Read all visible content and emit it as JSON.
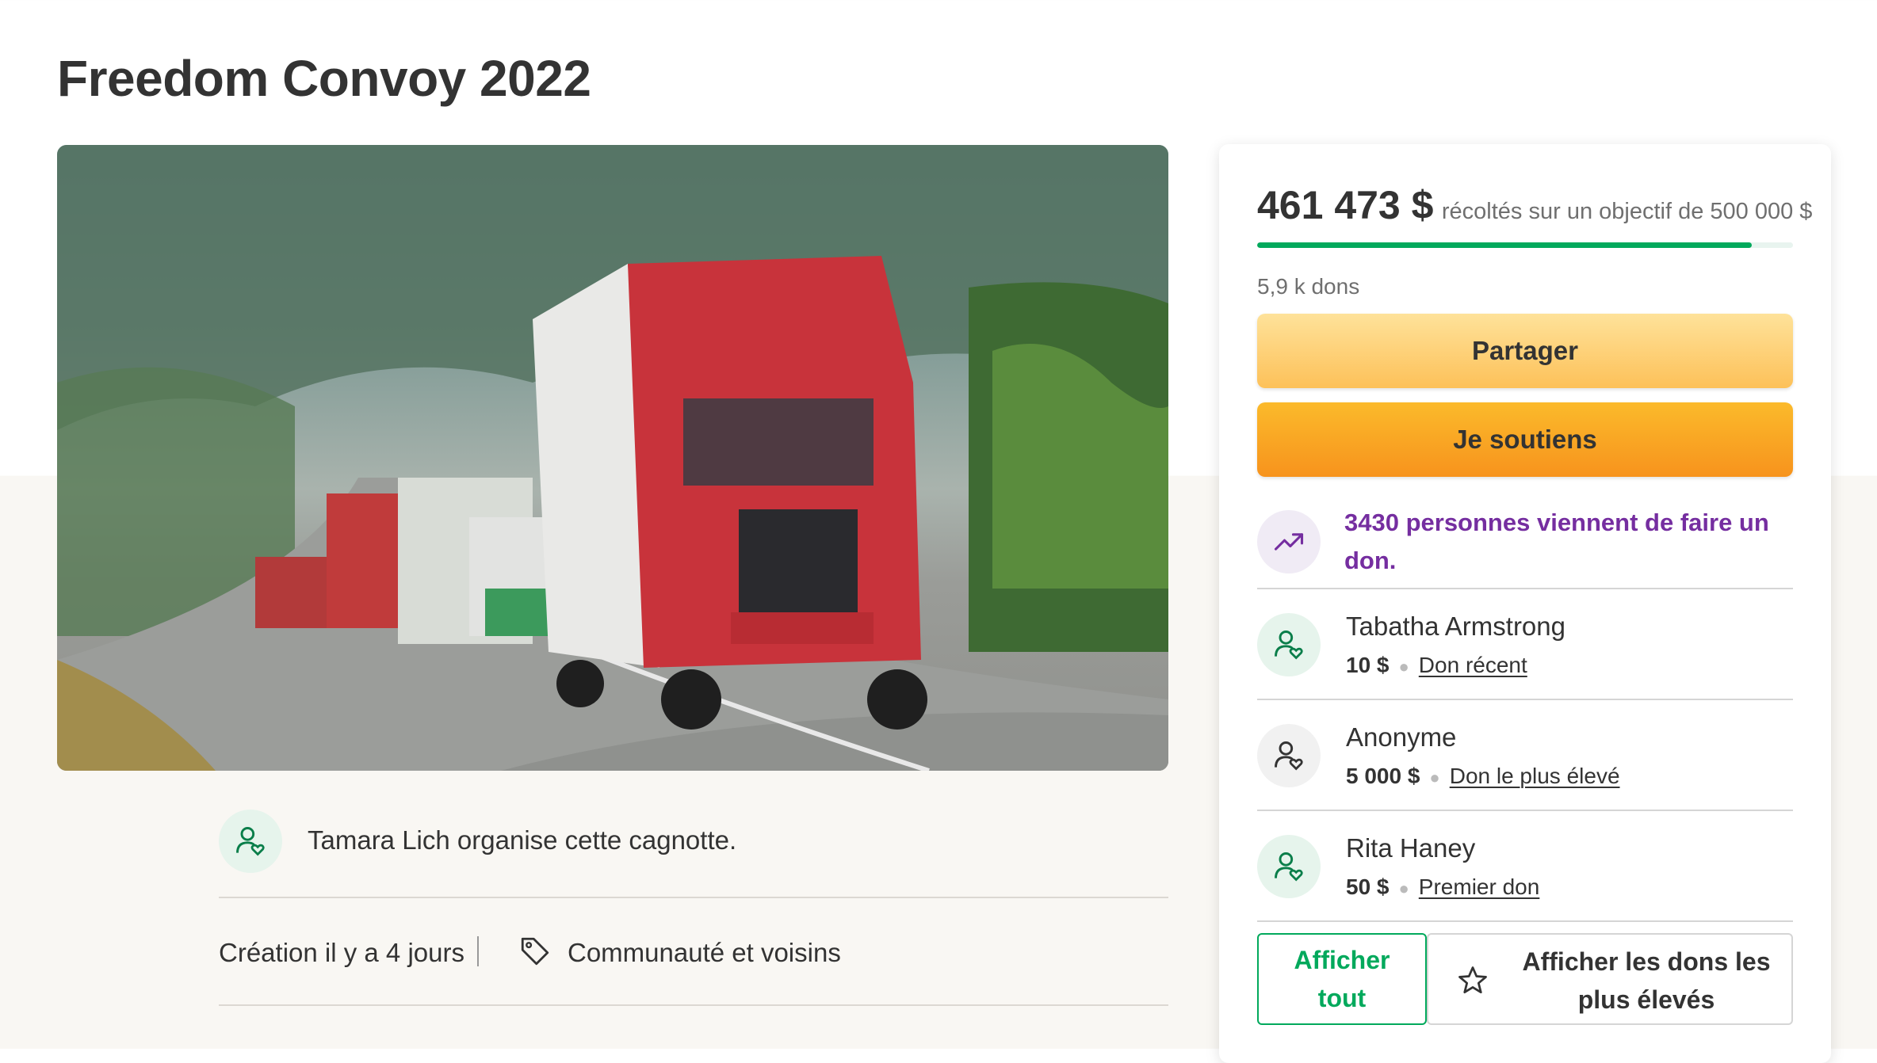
{
  "campaign": {
    "title": "Freedom Convoy 2022",
    "image_alt": "Convoi de camions sur une autoroute"
  },
  "organizer": {
    "text": "Tamara Lich organise cette cagnotte.",
    "icon": "user-heart-icon"
  },
  "meta": {
    "created": "Création il y a 4 jours",
    "category": "Communauté et voisins",
    "category_icon": "tag-icon"
  },
  "donation_panel": {
    "raised": "461 473 $",
    "goal_text": "récoltés sur un objectif de 500 000 $",
    "progress_fraction": 0.923,
    "donation_count": "5,9 k dons",
    "share_label": "Partager",
    "donate_label": "Je soutiens",
    "trend_text": "3430 personnes viennent de faire un don.",
    "trend_icon": "trending-up-icon",
    "donors": [
      {
        "name": "Tabatha Armstrong",
        "amount": "10 $",
        "tag": "Don récent",
        "icon": "user-heart-icon"
      },
      {
        "name": "Anonyme",
        "amount": "5 000 $",
        "tag": "Don le plus élevé",
        "icon": "user-heart-icon"
      },
      {
        "name": "Rita Haney",
        "amount": "50 $",
        "tag": "Premier don",
        "icon": "user-heart-icon"
      }
    ],
    "see_all_label": "Afficher tout",
    "see_top_label": "Afficher les dons les plus élevés",
    "see_top_icon": "star-icon"
  },
  "colors": {
    "brand_green": "#02a95c",
    "share_button": "#fdc159",
    "donate_button": "#f7931d",
    "trend_purple": "#752ea0"
  }
}
